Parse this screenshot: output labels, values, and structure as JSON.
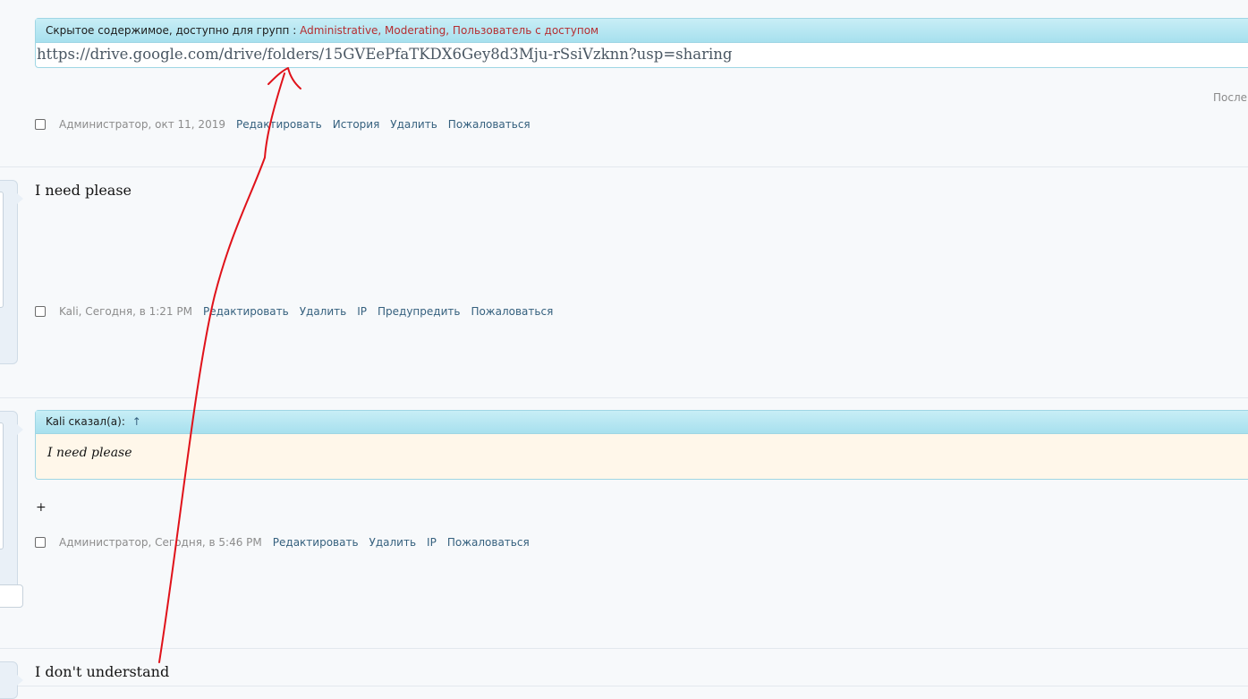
{
  "post1": {
    "hidden_label": "Скрытое содержимое, доступно для групп :",
    "hidden_groups": "Administrative, Moderating, Пользователь с доступом",
    "hidden_link": "https://drive.google.com/drive/folders/15GVEePfaTKDX6Gey8d3Mju-rSsiVzknn?usp=sharing",
    "last_edit_partial": "После",
    "author_date": "Администратор, окт 11, 2019",
    "actions": [
      "Редактировать",
      "История",
      "Удалить",
      "Пожаловаться"
    ]
  },
  "post2": {
    "text": "I need please",
    "author_date": "Kali, Сегодня, в 1:21 PM",
    "actions": [
      "Редактировать",
      "Удалить",
      "IP",
      "Предупредить",
      "Пожаловаться"
    ]
  },
  "post3": {
    "quote_author": "Kali сказал(а):",
    "quote_up": "↑",
    "quote_text": "I need please",
    "text": "+",
    "author_date": "Администратор, Сегодня, в 5:46 PM",
    "actions": [
      "Редактировать",
      "Удалить",
      "IP",
      "Пожаловаться"
    ]
  },
  "post4": {
    "text": "I don't understand"
  },
  "colors": {
    "link": "#35607e",
    "group_red": "#b52e31",
    "annotation_red": "#e0121a",
    "header_cyan": "#a7e0ee"
  }
}
